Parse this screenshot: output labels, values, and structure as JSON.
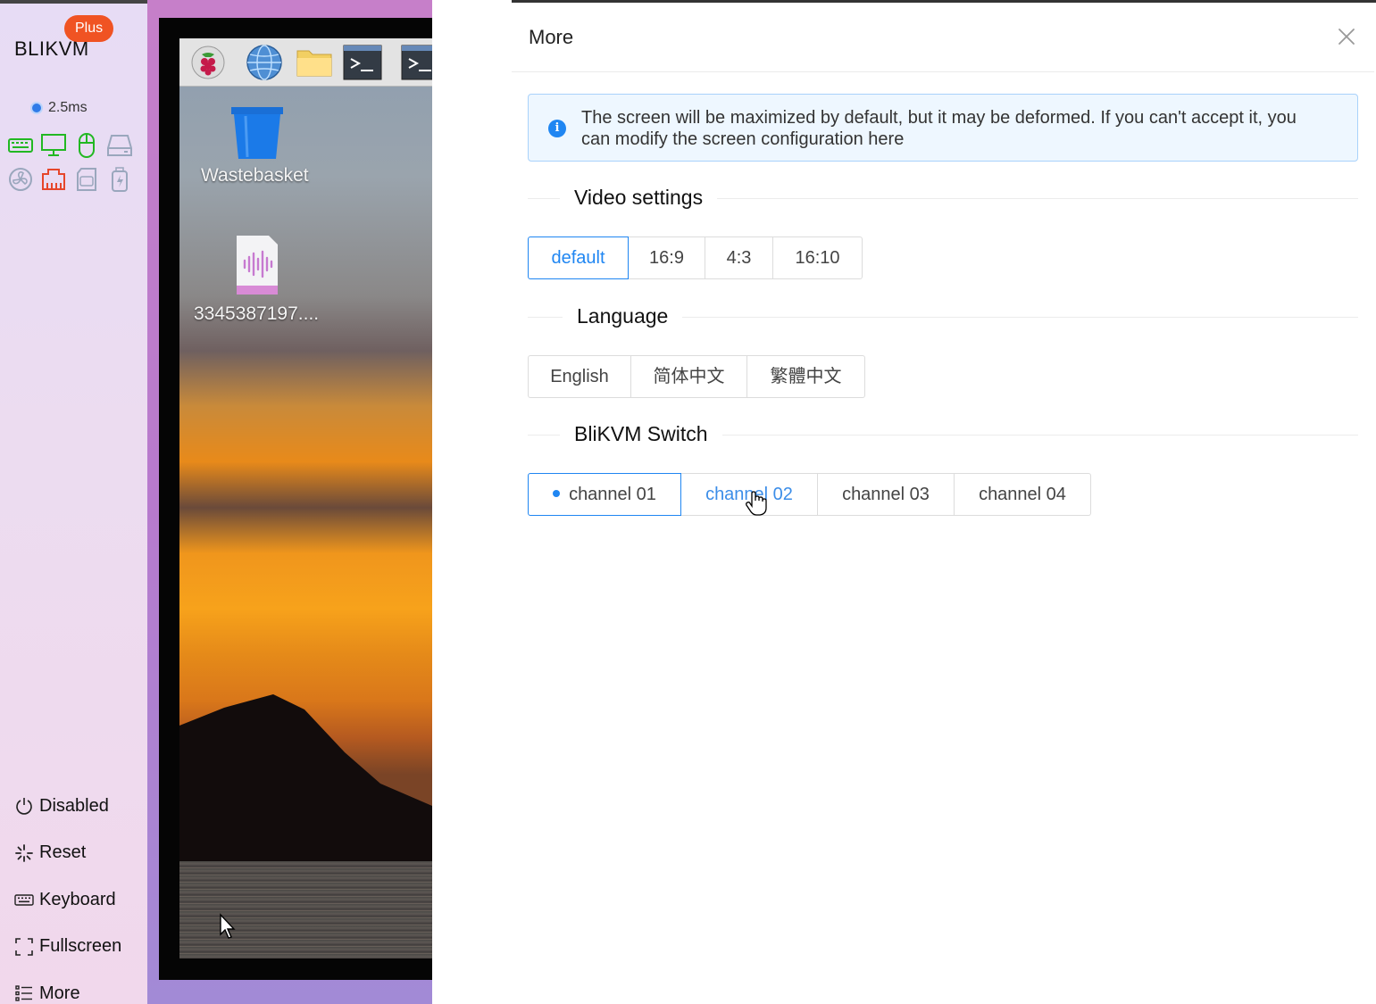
{
  "sidebar": {
    "brand": "BLIKVM",
    "badge": "Plus",
    "latency": "2.5ms",
    "status_icons": [
      "keyboard-icon",
      "monitor-icon",
      "mouse-icon",
      "drive-icon",
      "fan-icon",
      "ethernet-icon",
      "sd-card-icon",
      "usb-power-icon"
    ],
    "menu": [
      {
        "label": "Disabled",
        "icon": "power-icon"
      },
      {
        "label": "Reset",
        "icon": "reset-icon"
      },
      {
        "label": "Keyboard",
        "icon": "keyboard-icon"
      },
      {
        "label": "Fullscreen",
        "icon": "fullscreen-icon"
      },
      {
        "label": "More",
        "icon": "list-icon"
      }
    ]
  },
  "desktop": {
    "taskbar_icons": [
      "raspberry-icon",
      "globe-icon",
      "folder-icon",
      "terminal-icon",
      "terminal-icon"
    ],
    "icons": [
      {
        "label": "Wastebasket",
        "icon": "wastebasket-icon"
      },
      {
        "label": "3345387197....",
        "icon": "audio-file-icon"
      }
    ]
  },
  "dialog": {
    "title": "More",
    "info": "The screen will be maximized by default, but it may be deformed. If you can't accept it, you can modify the screen configuration here",
    "video": {
      "title": "Video settings",
      "options": [
        "default",
        "16:9",
        "4:3",
        "16:10"
      ],
      "selected": "default"
    },
    "language": {
      "title": "Language",
      "options": [
        "English",
        "简体中文",
        "繁體中文"
      ]
    },
    "switch": {
      "title": "BliKVM Switch",
      "options": [
        "channel 01",
        "channel 02",
        "channel 03",
        "channel 04"
      ],
      "selected": "channel 01",
      "hovered": "channel 02"
    },
    "colors": {
      "accent": "#1f86f2",
      "info_bg": "#eef7ff",
      "badge": "#f05323"
    }
  }
}
